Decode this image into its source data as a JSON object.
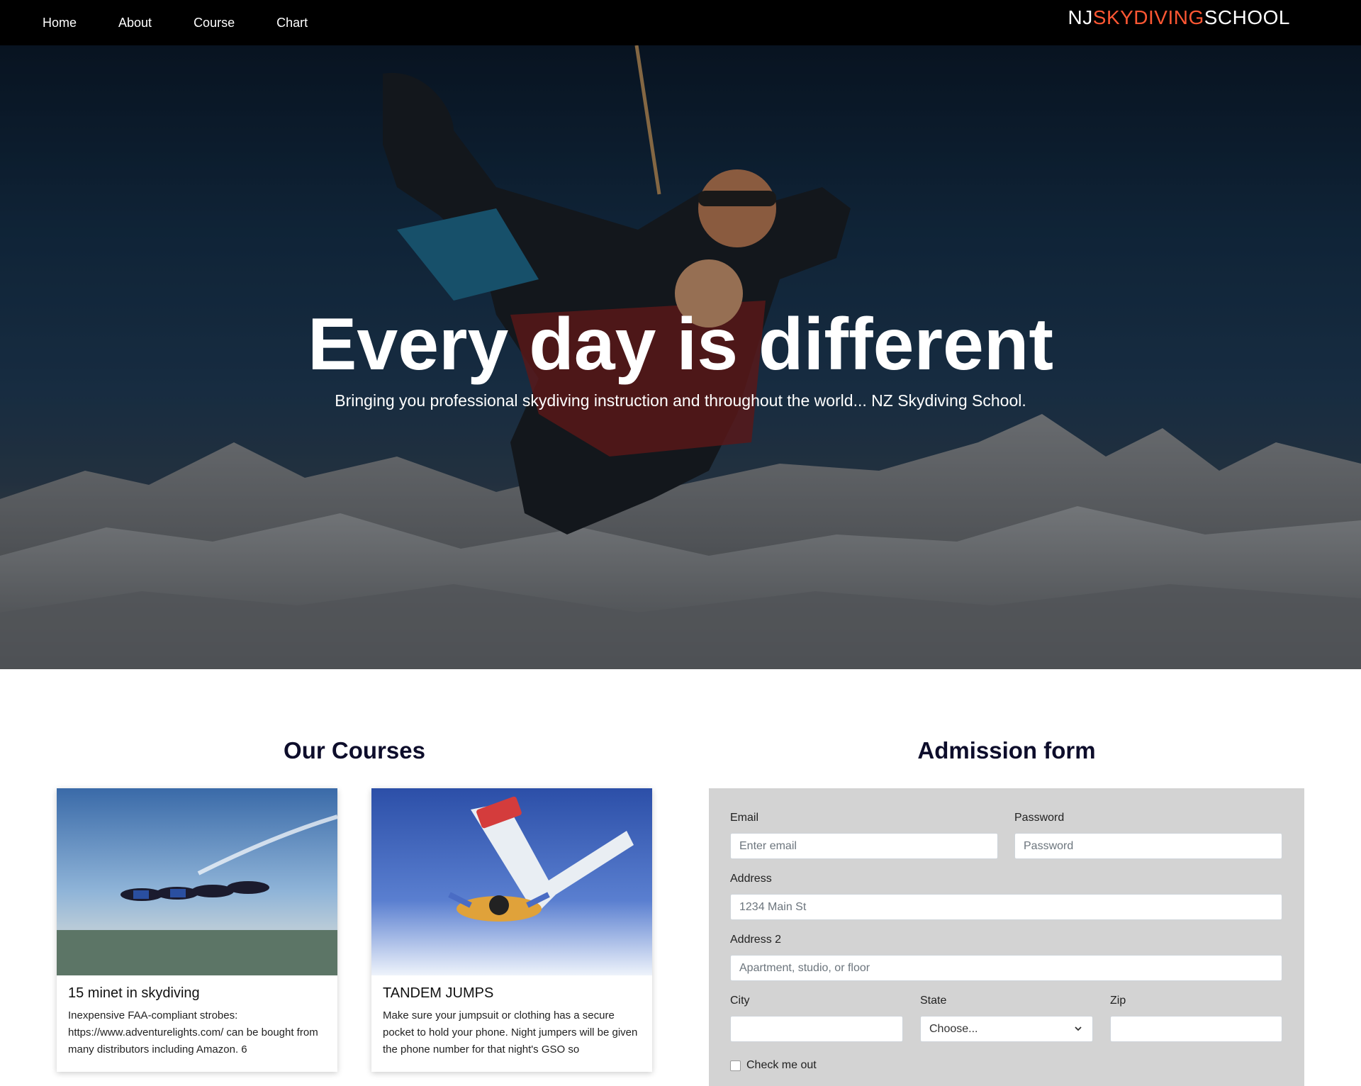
{
  "nav": {
    "items": [
      "Home",
      "About",
      "Course",
      "Chart"
    ]
  },
  "brand": {
    "part1": "NJ",
    "part2": "SKYDIVING",
    "part3": "SCHOOL",
    "accent_color": "#ff5733"
  },
  "hero": {
    "title": "Every day is different",
    "subtitle": "Bringing you professional skydiving instruction and throughout the world... NZ Skydiving School."
  },
  "courses": {
    "heading": "Our Courses",
    "cards": [
      {
        "title": "15 minet in skydiving",
        "text": "Inexpensive FAA-compliant strobes: https://www.adventurelights.com/ can be bought from many distributors including Amazon. 6"
      },
      {
        "title": "TANDEM JUMPS",
        "text": "Make sure your jumpsuit or clothing has a secure pocket to hold your phone. Night jumpers will be given the phone number for that night's GSO so"
      }
    ]
  },
  "form": {
    "heading": "Admission form",
    "email_label": "Email",
    "email_placeholder": "Enter email",
    "password_label": "Password",
    "password_placeholder": "Password",
    "address_label": "Address",
    "address_placeholder": "1234 Main St",
    "address2_label": "Address 2",
    "address2_placeholder": "Apartment, studio, or floor",
    "city_label": "City",
    "state_label": "State",
    "state_selected": "Choose...",
    "zip_label": "Zip",
    "check_label": "Check me out"
  }
}
